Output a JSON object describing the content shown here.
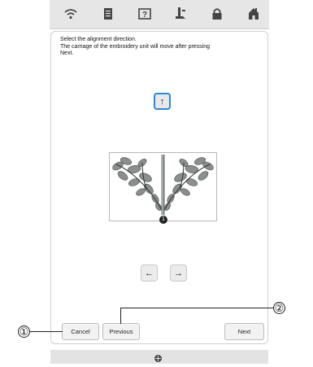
{
  "topbar": {
    "icons": [
      "wifi-icon",
      "document-icon",
      "help-icon",
      "presser-foot-icon",
      "lock-icon",
      "home-icon"
    ]
  },
  "instructions": {
    "line1": "Select the alignment direction.",
    "line2": "The carriage of the embroidery unit will move after pressing",
    "line3": "Next."
  },
  "direction_buttons": {
    "up": "↑",
    "left": "←",
    "right": "→"
  },
  "pattern": {
    "marker": "1"
  },
  "footer": {
    "cancel_label": "Cancel",
    "previous_label": "Previous",
    "next_label": "Next"
  },
  "callouts": {
    "one": "①",
    "two": "②"
  },
  "colors": {
    "accent": "#2a8ad8",
    "leaf": "#8a8f8c",
    "leaf_dark": "#4a504d"
  }
}
